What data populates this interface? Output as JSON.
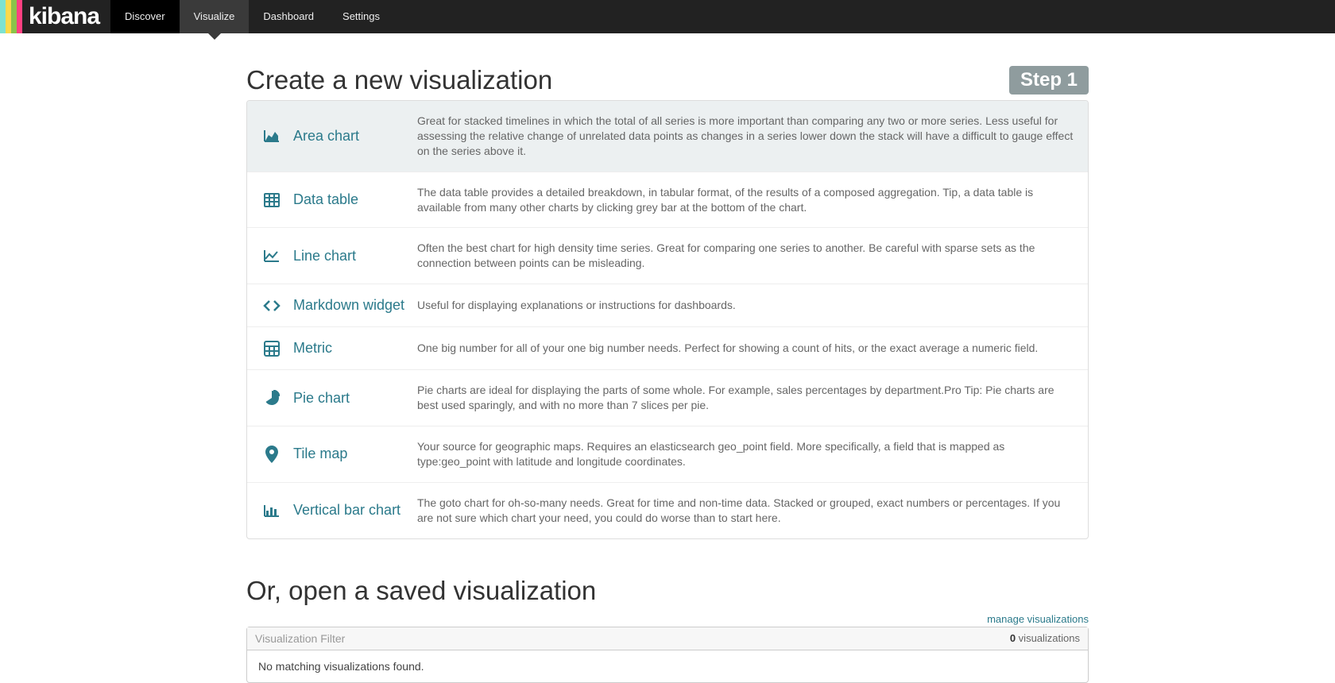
{
  "nav": {
    "logo_text": "kibana",
    "items": [
      {
        "label": "Discover",
        "active": false,
        "dark": true
      },
      {
        "label": "Visualize",
        "active": true,
        "dark": false
      },
      {
        "label": "Dashboard",
        "active": false,
        "dark": false
      },
      {
        "label": "Settings",
        "active": false,
        "dark": false
      }
    ]
  },
  "page": {
    "create_title": "Create a new visualization",
    "step_badge": "Step 1",
    "open_title": "Or, open a saved visualization",
    "manage_link": "manage visualizations",
    "filter_placeholder": "Visualization Filter",
    "viz_count_num": "0",
    "viz_count_label": " visualizations",
    "no_match": "No matching visualizations found."
  },
  "viz_types": [
    {
      "icon": "area-chart-icon",
      "name": "Area chart",
      "desc": "Great for stacked timelines in which the total of all series is more important than comparing any two or more series. Less useful for assessing the relative change of unrelated data points as changes in a series lower down the stack will have a difficult to gauge effect on the series above it.",
      "hovered": true
    },
    {
      "icon": "data-table-icon",
      "name": "Data table",
      "desc": "The data table provides a detailed breakdown, in tabular format, of the results of a composed aggregation. Tip, a data table is available from many other charts by clicking grey bar at the bottom of the chart."
    },
    {
      "icon": "line-chart-icon",
      "name": "Line chart",
      "desc": "Often the best chart for high density time series. Great for comparing one series to another. Be careful with sparse sets as the connection between points can be misleading."
    },
    {
      "icon": "markdown-icon",
      "name": "Markdown widget",
      "desc": "Useful for displaying explanations or instructions for dashboards."
    },
    {
      "icon": "metric-icon",
      "name": "Metric",
      "desc": "One big number for all of your one big number needs. Perfect for showing a count of hits, or the exact average a numeric field."
    },
    {
      "icon": "pie-chart-icon",
      "name": "Pie chart",
      "desc": "Pie charts are ideal for displaying the parts of some whole. For example, sales percentages by department.Pro Tip: Pie charts are best used sparingly, and with no more than 7 slices per pie."
    },
    {
      "icon": "tile-map-icon",
      "name": "Tile map",
      "desc": "Your source for geographic maps. Requires an elasticsearch geo_point field. More specifically, a field that is mapped as type:geo_point with latitude and longitude coordinates."
    },
    {
      "icon": "bar-chart-icon",
      "name": "Vertical bar chart",
      "desc": "The goto chart for oh-so-many needs. Great for time and non-time data. Stacked or grouped, exact numbers or percentages. If you are not sure which chart your need, you could do worse than to start here."
    }
  ]
}
